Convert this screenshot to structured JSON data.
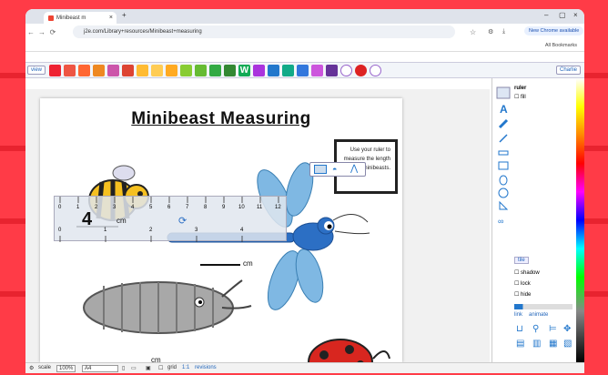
{
  "browser": {
    "tab_title": "Minibeast m",
    "url": "j2e.com/Library+resources/Minibeast+measuring",
    "new_chrome": "New Chrome available",
    "all_bookmarks": "All Bookmarks"
  },
  "toolbar": {
    "view_label": "view",
    "user_label": "Charlie"
  },
  "page": {
    "title": "Minibeast Measuring",
    "instruction": "Use your ruler to measure the length of these minibeasts.",
    "answer": "4",
    "cm1": "cm",
    "cm2": "cm",
    "cm3": "cm"
  },
  "ruler": {
    "top_ticks": [
      "0",
      "1",
      "2",
      "3",
      "4",
      "5",
      "6",
      "7",
      "8",
      "9",
      "10",
      "11",
      "12"
    ],
    "bottom_ticks": [
      "0",
      "1",
      "2",
      "3",
      "4"
    ]
  },
  "panel": {
    "ruler_label": "ruler",
    "fill_label": "fill",
    "tile_label": "tile",
    "shadow_label": "shadow",
    "lock_label": "lock",
    "hide_label": "hide",
    "link_label": "link",
    "animate_label": "animate"
  },
  "status": {
    "scale_label": "scale",
    "scale_value": "100%",
    "paper_value": "A4",
    "grid_label": "grid",
    "rev_icon": "1:1",
    "revisions_label": "revisions"
  },
  "colors": {
    "accent": "#ff3b47",
    "link": "#2266bb"
  }
}
